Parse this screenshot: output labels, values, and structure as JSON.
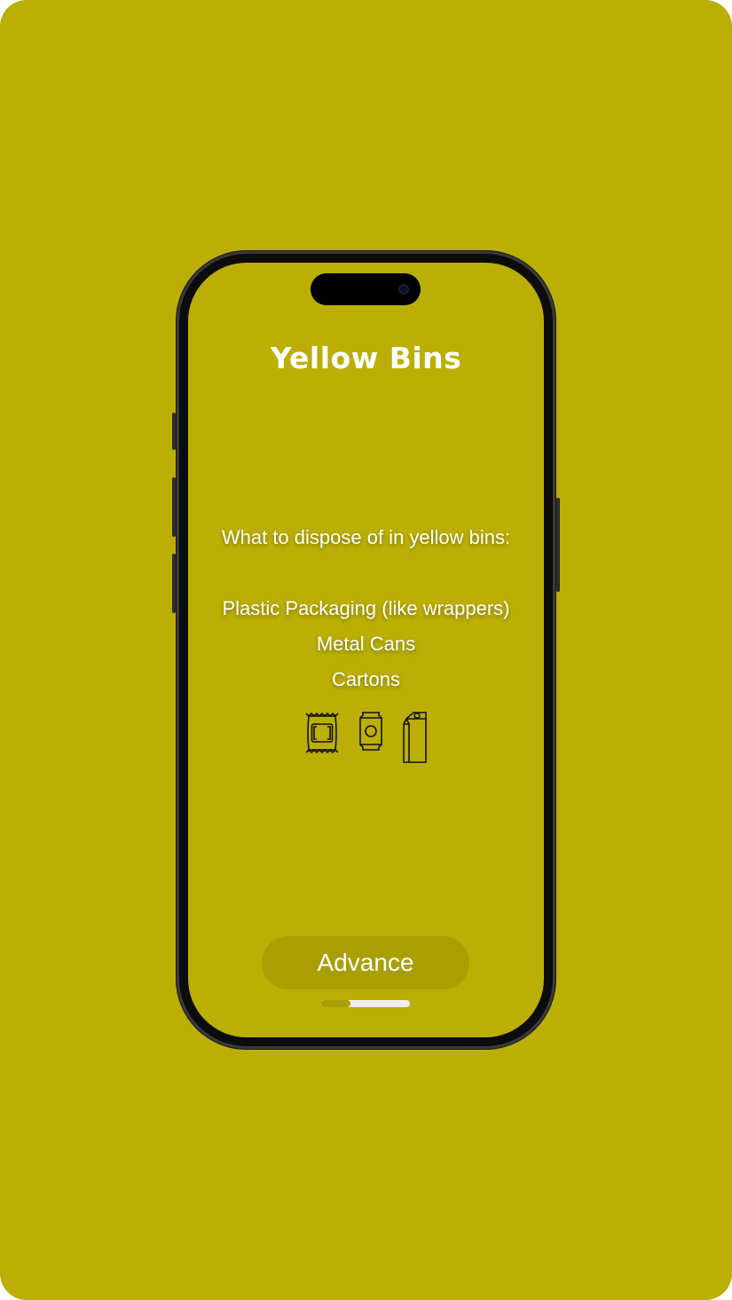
{
  "colors": {
    "background": "#bbaf05",
    "button": "#a99e04",
    "text": "#ffffff"
  },
  "screen": {
    "title": "Yellow Bins",
    "intro": "What to dispose of in yellow bins:",
    "items": [
      "Plastic Packaging (like wrappers)",
      "Metal Cans",
      "Cartons"
    ],
    "icons": [
      "wrapper-icon",
      "can-icon",
      "carton-icon"
    ],
    "advance_label": "Advance",
    "progress": 0.33
  }
}
